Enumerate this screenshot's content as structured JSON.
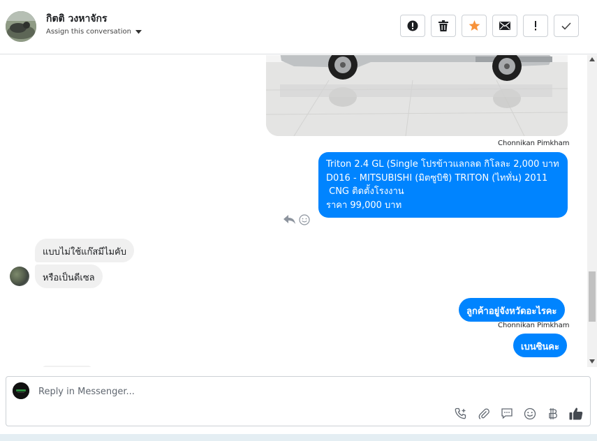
{
  "header": {
    "contact_name": "กิตติ วงหาจักร",
    "assign_label": "Assign this conversation",
    "toolbar": [
      {
        "name": "spam-button",
        "icon": "alert-circle-icon"
      },
      {
        "name": "delete-button",
        "icon": "trash-icon"
      },
      {
        "name": "star-button",
        "icon": "star-icon"
      },
      {
        "name": "mark-unread-button",
        "icon": "envelope-icon"
      },
      {
        "name": "important-button",
        "icon": "exclamation-icon"
      },
      {
        "name": "mark-done-button",
        "icon": "check-icon"
      }
    ]
  },
  "thread": {
    "image_sender": "Chonnikan Pimkham",
    "long_message": {
      "lines": [
        "Triton 2.4 GL (Single โปรข้าวแลกลด กิโลละ 2,000 บาท",
        "D016 - MITSUBISHI (มิตซูบิชิ) TRITON (ไททั่น) 2011",
        "",
        " CNG ติดตั้งโรงงาน",
        "ราคา 99,000 บาท"
      ]
    },
    "incoming": [
      "แบบไม่ใช้แก๊สมีไมคับ",
      "หรือเป็นดีเซล"
    ],
    "outgoing_question": "ลูกค้าอยู่จังหวัดอะไรคะ",
    "question_sender": "Chonnikan Pimkham",
    "outgoing_answer": "เบนซินคะ"
  },
  "composer": {
    "placeholder": "Reply in Messenger...",
    "tools": [
      "phone-plus-icon",
      "paperclip-icon",
      "chat-bubble-icon",
      "smiley-icon",
      "baht-icon",
      "thumbs-up-icon"
    ]
  },
  "colors": {
    "outgoing_bubble": "#0084ff",
    "incoming_bubble": "#f0f0f0",
    "star": "#f7923a"
  }
}
